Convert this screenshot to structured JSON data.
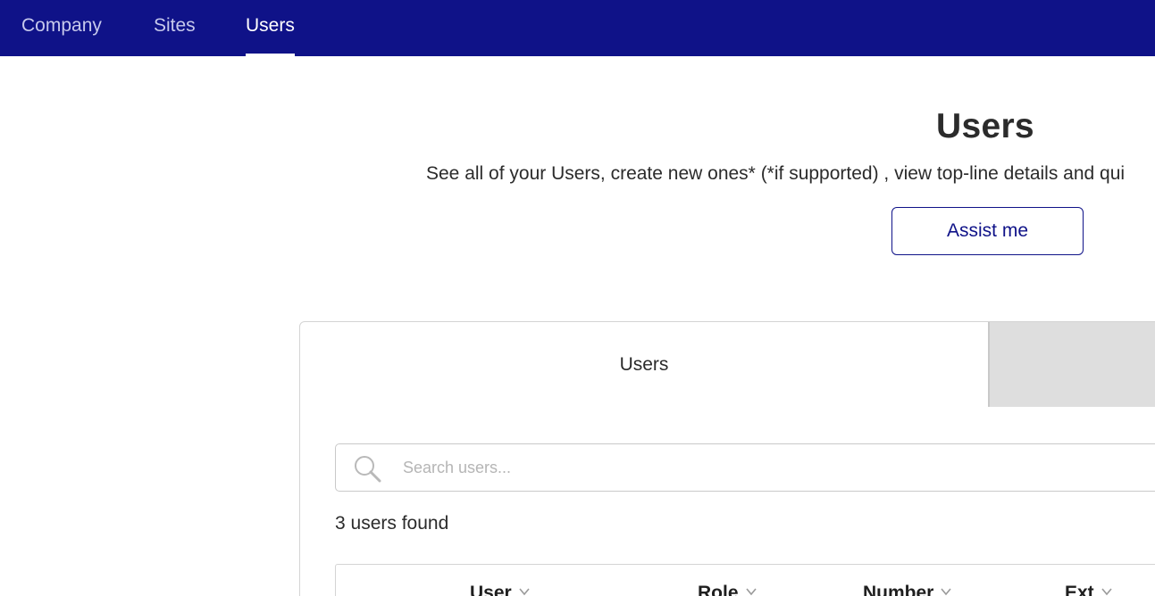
{
  "nav": {
    "items": [
      {
        "label": "Company"
      },
      {
        "label": "Sites"
      },
      {
        "label": "Users"
      }
    ],
    "active": "Users"
  },
  "header": {
    "title": "Users",
    "subtitle": "See all of your Users, create new ones* (*if supported) , view top-line details and qui",
    "assist_label": "Assist me"
  },
  "tabs": [
    {
      "label": "Users"
    },
    {
      "label": ""
    }
  ],
  "search": {
    "placeholder": "Search users...",
    "value": ""
  },
  "results": {
    "count_text": "3 users found"
  },
  "table": {
    "columns": [
      "User",
      "Role",
      "Number",
      "Ext"
    ]
  },
  "colors": {
    "nav_bg": "#0f1288",
    "accent": "#0f1288",
    "inactive_tab": "#dedede"
  },
  "icons": {
    "search": "search-icon",
    "sort": "chevron-down-icon"
  }
}
